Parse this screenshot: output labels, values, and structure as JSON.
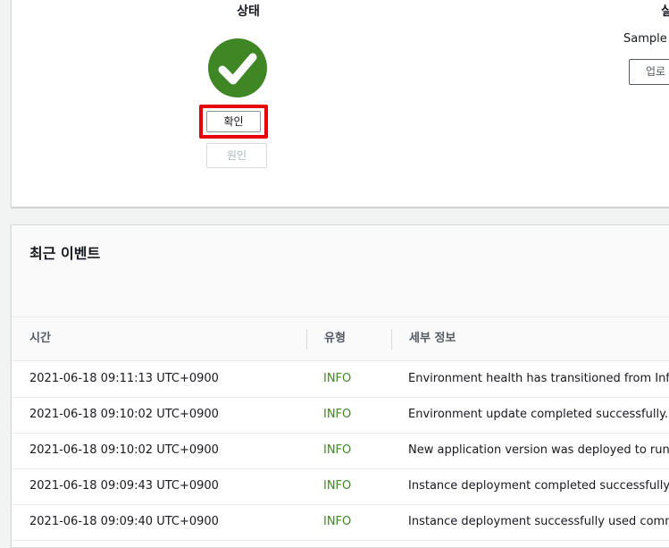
{
  "status_panel": {
    "title": "상태",
    "right_title": "실",
    "confirm_label": "확인",
    "cause_label": "원인",
    "sample_text": "Sample A",
    "upload_label": "업로",
    "status_color": "#3f8624",
    "highlight_color": "#e60000",
    "status_icon": "check-circle-icon"
  },
  "events": {
    "title": "최근 이벤트",
    "columns": {
      "time": "시간",
      "type": "유형",
      "detail": "세부 정보"
    },
    "rows": [
      {
        "time": "2021-06-18 09:11:13 UTC+0900",
        "type": "INFO",
        "detail": "Environment health has transitioned from Info"
      },
      {
        "time": "2021-06-18 09:10:02 UTC+0900",
        "type": "INFO",
        "detail": "Environment update completed successfully."
      },
      {
        "time": "2021-06-18 09:10:02 UTC+0900",
        "type": "INFO",
        "detail": "New application version was deployed to runn"
      },
      {
        "time": "2021-06-18 09:09:43 UTC+0900",
        "type": "INFO",
        "detail": "Instance deployment completed successfully."
      },
      {
        "time": "2021-06-18 09:09:40 UTC+0900",
        "type": "INFO",
        "detail": "Instance deployment successfully used comma"
      }
    ],
    "type_color": "#3f8624"
  }
}
